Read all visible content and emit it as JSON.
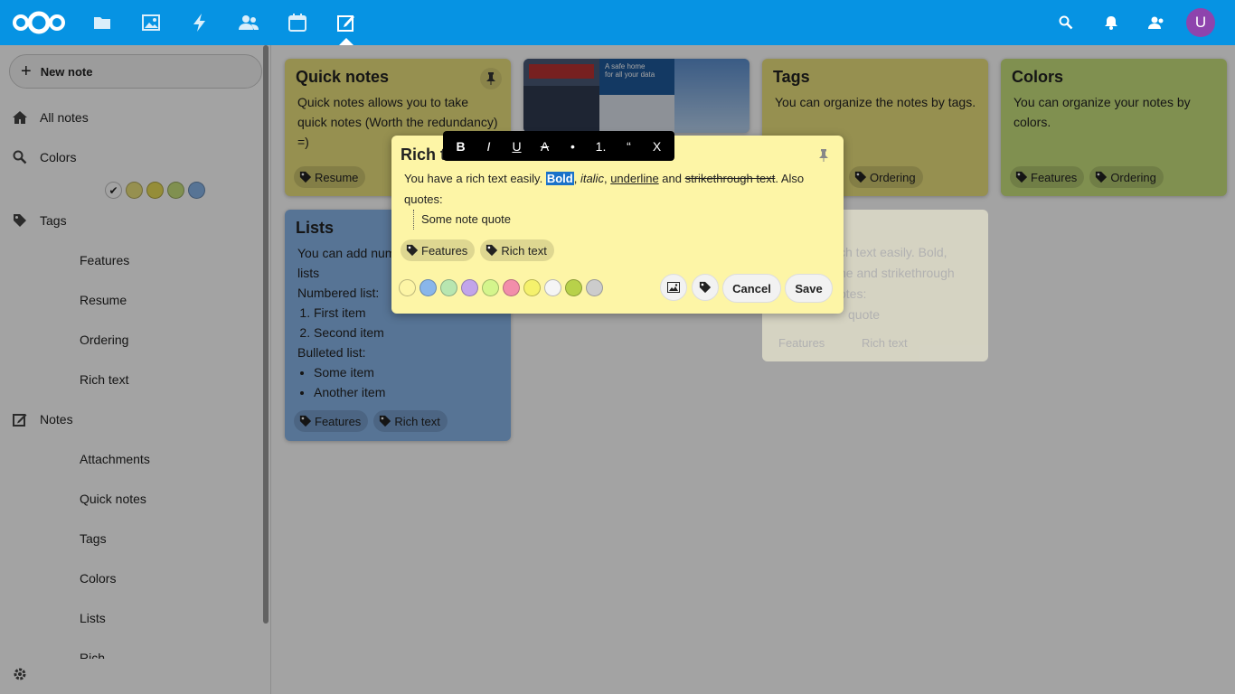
{
  "header": {
    "apps": [
      "files-icon",
      "photos-icon",
      "activity-icon",
      "contacts-icon",
      "calendar-icon",
      "notes-icon"
    ],
    "avatar_letter": "U",
    "colors": {
      "bar": "#0693e3",
      "avatar": "#8e44ad"
    }
  },
  "sidebar": {
    "new_note": "New note",
    "all_notes": "All notes",
    "colors": "Colors",
    "color_swatches": [
      "#ffffff",
      "#ebe17e",
      "#e9dd58",
      "#c9e17e",
      "#89b6ea"
    ],
    "tags": "Tags",
    "tag_items": [
      "Features",
      "Resume",
      "Ordering",
      "Rich text"
    ],
    "notes": "Notes",
    "note_items": [
      "Attachments",
      "Quick notes",
      "Tags",
      "Colors",
      "Lists",
      "Rich"
    ]
  },
  "cards": {
    "quick_notes": {
      "title": "Quick notes",
      "body": "Quick notes allows you to take quick notes (Worth the redundancy) =)",
      "tags": [
        "Resume"
      ]
    },
    "tags": {
      "title": "Tags",
      "body": "You can organize the notes by tags.",
      "tags": [
        "Ordering"
      ]
    },
    "colors": {
      "title": "Colors",
      "body": "You can organize your notes by colors.",
      "tags": [
        "Features",
        "Ordering"
      ]
    },
    "lists": {
      "title": "Lists",
      "intro": "You can add num lists",
      "numbered_label": "Numbered list:",
      "numbered": [
        "First item",
        "Second item"
      ],
      "bulleted_label": "Bulleted list:",
      "bulleted": [
        "Some item",
        "Another item"
      ],
      "tags": [
        "Features",
        "Rich text"
      ]
    },
    "image_card": {
      "promo_line1": "A safe home",
      "promo_line2": "for all your data"
    }
  },
  "editor": {
    "title": "Rich t",
    "toolbar": [
      "B",
      "I",
      "U",
      "A",
      "•",
      "1.",
      "“",
      "X"
    ],
    "text_before": "You have a rich text easily. ",
    "bold": "Bold",
    "comma1": ", ",
    "italic": "italic",
    "comma2": ", ",
    "underline": "underline",
    "and": " and ",
    "strike": "strikethrough text",
    "after": ". Also quotes:",
    "quote": "Some note quote",
    "tags": [
      "Features",
      "Rich text"
    ],
    "palette": [
      "#fdf5a6",
      "#89b6ea",
      "#b8e6b0",
      "#c2a5ea",
      "#d4f58c",
      "#f28eaa",
      "#f5f16c",
      "#f5f5f5",
      "#b8d14a",
      "#cccccc"
    ],
    "cancel": "Cancel",
    "save": "Save"
  },
  "ghost": {
    "line1": "ch text easily. Bold,",
    "line2": "ne and strikethrough",
    "line3": "otes:",
    "line4": "quote",
    "tags": [
      "Features",
      "Rich text"
    ]
  }
}
